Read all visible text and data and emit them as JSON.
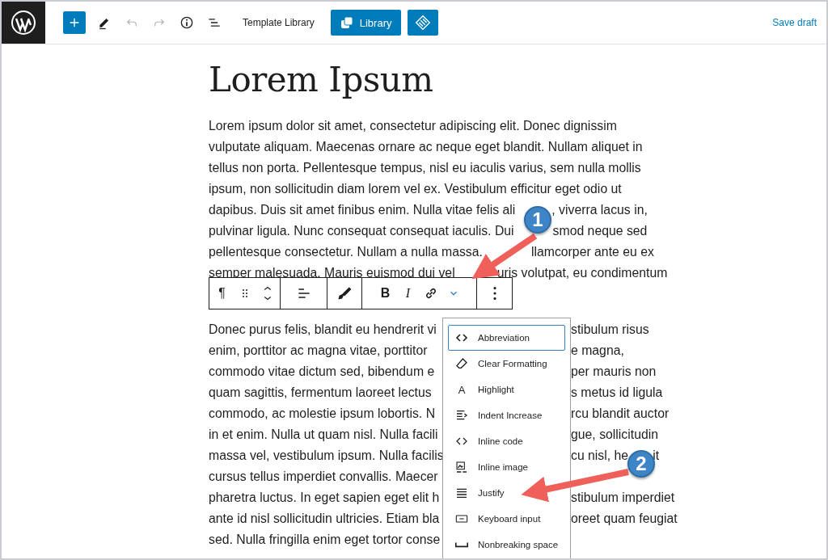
{
  "header": {
    "tools": [
      {
        "kind": "add"
      },
      {
        "kind": "edit"
      },
      {
        "kind": "undo",
        "disabled": true
      },
      {
        "kind": "redo",
        "disabled": true
      },
      {
        "kind": "info"
      },
      {
        "kind": "list"
      }
    ],
    "template_label": "Template Library",
    "library_button": "Library",
    "save_draft": "Save draft"
  },
  "title": "Lorem Ipsum",
  "paragraph_1": [
    [
      "Lorem ipsum dolor sit amet, consectetur adipiscing elit. Donec dignissim"
    ],
    [
      "vulputate aliquam. Maecenas ornare ac neque eget blandit. Nullam aliquet in"
    ],
    [
      "tellus non porta. Pellentesque tempus, nisl eu iaculis varius, sem nulla mollis"
    ],
    [
      "ipsum, non sollicitudin diam lorem vel ex. Vestibulum efficitur eget odio ut"
    ],
    [
      "dapibus. Duis sit amet finibus enim. Nulla vitae felis ali",
      ", viverra lacus in,"
    ],
    [
      "pulvinar ligula. Nunc consequat consequat iaculis. Dui",
      "smod neque sed"
    ],
    [
      "pellentesque consectetur. Nullam a nulla massa.",
      "llamcorper ante eu ex"
    ],
    [
      "semper malesuada. Mauris euismod dui vel",
      "uris volutpat, eu condimentum"
    ]
  ],
  "block_toolbar": [
    [
      {
        "kind": "paragraph",
        "label": "¶"
      },
      {
        "kind": "drag"
      },
      {
        "kind": "move"
      }
    ],
    [
      {
        "kind": "align"
      }
    ],
    [
      {
        "kind": "brush"
      }
    ],
    [
      {
        "kind": "bold",
        "label": "B"
      },
      {
        "kind": "italic",
        "label": "I"
      },
      {
        "kind": "link"
      },
      {
        "kind": "more"
      }
    ],
    [
      {
        "kind": "options"
      }
    ]
  ],
  "paragraph_2": [
    {
      "left": "Donec purus felis, blandit eu hendrerit vi",
      "right": "stibulum risus"
    },
    {
      "left": "enim, porttitor ac magna vitae, porttitor",
      "right": "e magna,"
    },
    {
      "left": "commodo vitae dictum sed, bibendum e",
      "right": "per mauris non"
    },
    {
      "left": "quam sagittis, fermentum laoreet lectus",
      "right": "s metus id ligula"
    },
    {
      "left": "commodo, ac molestie ipsum lobortis. N",
      "right": "rcu blandit auctor"
    },
    {
      "left": "in et enim. Nulla ut quam nisl. Nulla facili",
      "right": "gue, sollicitudin"
    },
    {
      "left": "massa vel, vestibulum ipsum. Nulla facilis",
      "right": "cu nisl, he",
      "right_2": "it"
    },
    {
      "left": "cursus tellus imperdiet convallis. Maecer"
    },
    {
      "left": "pharetra luctus. In eget sapien eget elit h",
      "right": "stibulum imperdiet"
    },
    {
      "left": "ante id nisl sollicitudin ultricies. Etiam bla",
      "right": "oreet quam feugiat"
    },
    {
      "left": "sed. Nulla fringilla enim eget tortor conse"
    }
  ],
  "format_menu": [
    {
      "kind": "abbr",
      "label": "Abbreviation",
      "selected": true
    },
    {
      "kind": "eraser",
      "label": "Clear Formatting",
      "selected": false
    },
    {
      "kind": "letter",
      "icon_char": "A",
      "label": "Highlight",
      "selected": false
    },
    {
      "kind": "indent",
      "label": "Indent Increase",
      "selected": false
    },
    {
      "kind": "code",
      "label": "Inline code",
      "selected": false
    },
    {
      "kind": "image",
      "label": "Inline image",
      "selected": false
    },
    {
      "kind": "justify",
      "label": "Justify",
      "selected": false
    },
    {
      "kind": "keyboard",
      "label": "Keyboard input",
      "selected": false
    },
    {
      "kind": "nbsp",
      "label": "Nonbreaking space",
      "selected": false
    }
  ],
  "callouts": [
    "1",
    "2"
  ]
}
